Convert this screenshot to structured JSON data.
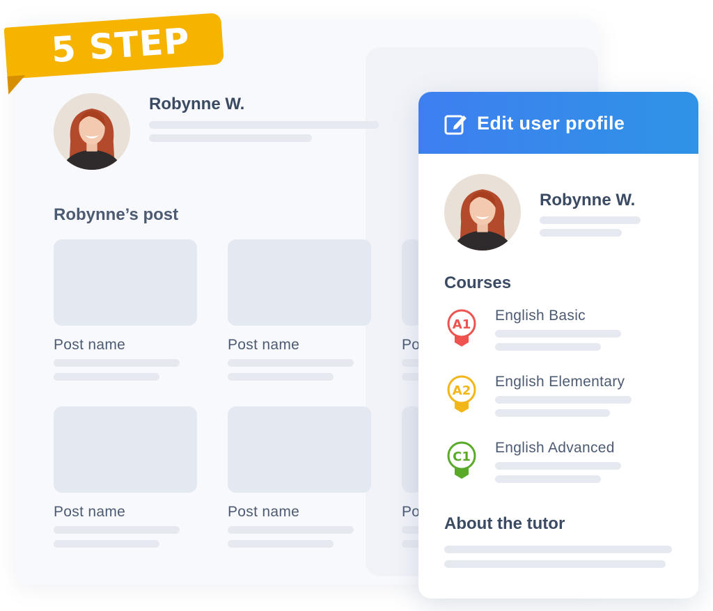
{
  "ribbon": {
    "label": "5 STEP",
    "color": "#f6b400"
  },
  "left_panel": {
    "user_name": "Robynne W.",
    "posts_title": "Robynne’s post",
    "posts": [
      {
        "name": "Post name"
      },
      {
        "name": "Post name"
      },
      {
        "name": "Po"
      },
      {
        "name": "Post name"
      },
      {
        "name": "Post name"
      },
      {
        "name": "Po"
      }
    ]
  },
  "profile": {
    "header_title": "Edit user profile",
    "header_icon": "edit-icon",
    "user_name": "Robynne W.",
    "courses_title": "Courses",
    "courses": [
      {
        "name": "English Basic",
        "level": "A1",
        "color": "#ef5350"
      },
      {
        "name": "English Elementary",
        "level": "A2",
        "color": "#f3b619"
      },
      {
        "name": "English Advanced",
        "level": "C1",
        "color": "#5aaa2a"
      }
    ],
    "about_title": "About the tutor"
  },
  "colors": {
    "accent": "#3e7ff0",
    "text": "#3b4a63",
    "placeholder": "#e6e9f0"
  }
}
